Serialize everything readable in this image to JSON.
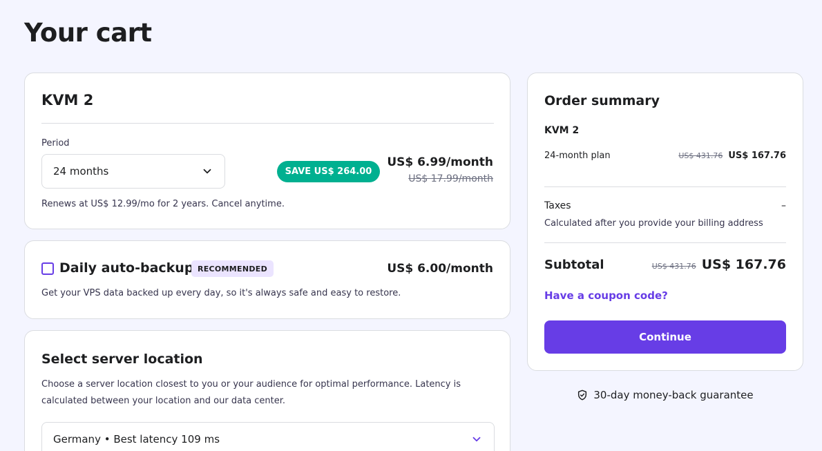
{
  "page": {
    "title": "Your cart"
  },
  "product": {
    "name": "KVM 2",
    "period_label": "Period",
    "period_value": "24 months",
    "save_badge": "SAVE US$ 264.00",
    "price": "US$ 6.99/month",
    "old_price": "US$ 17.99/month",
    "renew_note": "Renews at US$ 12.99/mo for 2 years. Cancel anytime."
  },
  "backup": {
    "checked": false,
    "title": "Daily auto-backup",
    "badge": "RECOMMENDED",
    "price": "US$ 6.00/month",
    "description": "Get your VPS data backed up every day, so it's always safe and easy to restore."
  },
  "location": {
    "title": "Select server location",
    "description": "Choose a server location closest to you or your audience for optimal performance. Latency is calculated between your location and our data center.",
    "selected": "Germany • Best latency 109 ms"
  },
  "summary": {
    "title": "Order summary",
    "product_name": "KVM 2",
    "plan_label": "24-month plan",
    "plan_old_price": "US$ 431.76",
    "plan_price": "US$ 167.76",
    "taxes_label": "Taxes",
    "taxes_value": "–",
    "taxes_note": "Calculated after you provide your billing address",
    "subtotal_label": "Subtotal",
    "subtotal_old_price": "US$ 431.76",
    "subtotal_price": "US$ 167.76",
    "coupon_link": "Have a coupon code?",
    "continue_label": "Continue"
  },
  "guarantee": {
    "text": "30-day money-back guarantee",
    "icon": "shield-check-icon"
  },
  "colors": {
    "brand_purple": "#673de6",
    "save_green": "#00b090",
    "badge_lavender": "#ebe4ff",
    "page_background": "#f4f5ff"
  }
}
